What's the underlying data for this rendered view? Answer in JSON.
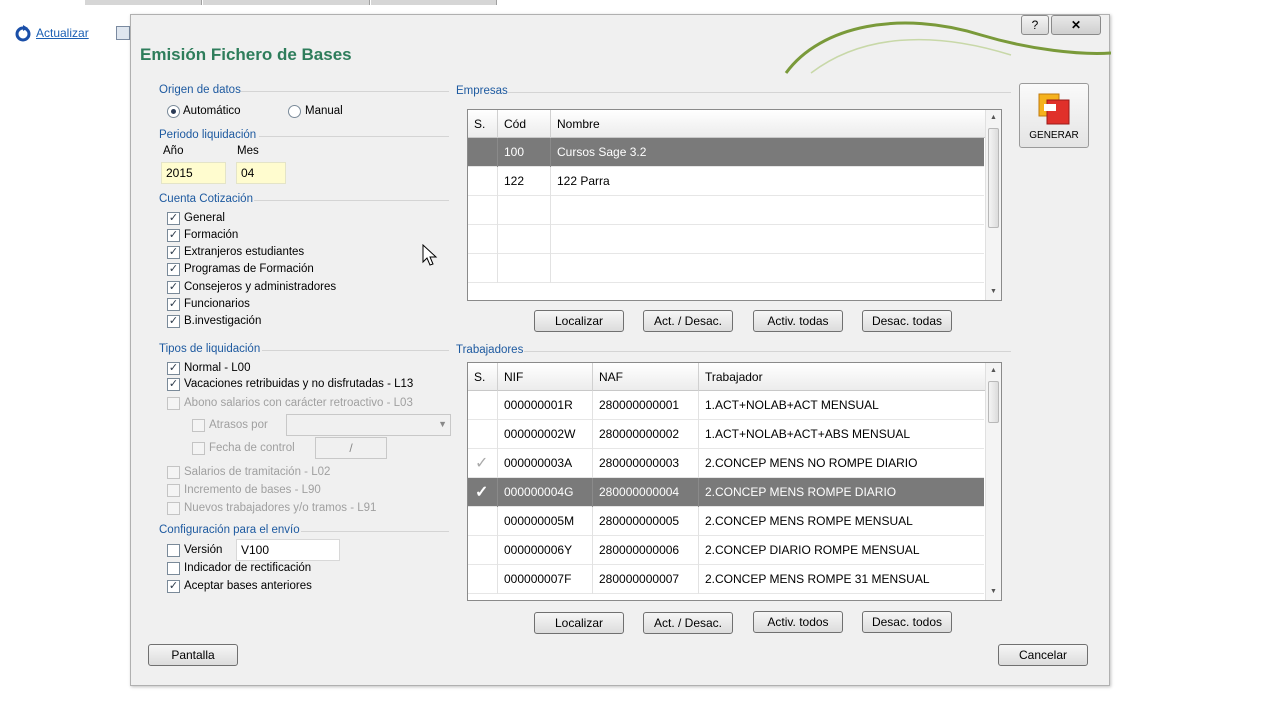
{
  "toolbar": {
    "refresh_label": "Actualizar"
  },
  "dialog": {
    "title": "Emisión Fichero de Bases",
    "help_label": "?",
    "close_label": "✕",
    "generate_label": "GENERAR",
    "pantalla_label": "Pantalla",
    "cancel_label": "Cancelar"
  },
  "origen": {
    "legend": "Origen de datos",
    "auto_label": "Automático",
    "manual_label": "Manual",
    "selected": "Automático"
  },
  "periodo": {
    "legend": "Periodo liquidación",
    "year_label": "Año",
    "month_label": "Mes",
    "year_value": "2015",
    "month_value": "04"
  },
  "cuenta": {
    "legend": "Cuenta Cotización",
    "items": [
      {
        "label": "General",
        "checked": true
      },
      {
        "label": "Formación",
        "checked": true
      },
      {
        "label": "Extranjeros estudiantes",
        "checked": true
      },
      {
        "label": "Programas de Formación",
        "checked": true
      },
      {
        "label": "Consejeros y administradores",
        "checked": true
      },
      {
        "label": "Funcionarios",
        "checked": true
      },
      {
        "label": "B.investigación",
        "checked": true
      }
    ]
  },
  "tipos": {
    "legend": "Tipos de liquidación",
    "normal": "Normal - L00",
    "vacaciones": "Vacaciones retribuidas y no disfrutadas - L13",
    "abono": "Abono salarios con carácter retroactivo - L03",
    "atrasos": "Atrasos por",
    "fecha_control": "Fecha de control",
    "fecha_value": "/",
    "salarios": "Salarios de tramitación - L02",
    "incremento": "Incremento de bases - L90",
    "nuevos": "Nuevos trabajadores y/o tramos - L91"
  },
  "config": {
    "legend": "Configuración para el envío",
    "version_label": "Versión",
    "version_value": "V100",
    "indicador_label": "Indicador de rectificación",
    "aceptar_label": "Aceptar bases anteriores"
  },
  "empresas": {
    "legend": "Empresas",
    "columns": [
      "S.",
      "Cód",
      "Nombre"
    ],
    "rows": [
      {
        "cod": "100",
        "nombre": "Cursos Sage 3.2",
        "selected": true
      },
      {
        "cod": "122",
        "nombre": "122 Parra",
        "selected": false
      }
    ],
    "buttons": [
      "Localizar",
      "Act. / Desac.",
      "Activ. todas",
      "Desac. todas"
    ]
  },
  "trabajadores": {
    "legend": "Trabajadores",
    "columns": [
      "S.",
      "NIF",
      "NAF",
      "Trabajador"
    ],
    "rows": [
      {
        "mark": "",
        "nif": "000000001R",
        "naf": "280000000001",
        "trabajador": "1.ACT+NOLAB+ACT MENSUAL",
        "selected": false
      },
      {
        "mark": "",
        "nif": "000000002W",
        "naf": "280000000002",
        "trabajador": "1.ACT+NOLAB+ACT+ABS MENSUAL",
        "selected": false
      },
      {
        "mark": "✓",
        "nif": "000000003A",
        "naf": "280000000003",
        "trabajador": "2.CONCEP MENS NO ROMPE DIARIO",
        "selected": false
      },
      {
        "mark": "✓",
        "nif": "000000004G",
        "naf": "280000000004",
        "trabajador": "2.CONCEP MENS ROMPE DIARIO",
        "selected": true
      },
      {
        "mark": "",
        "nif": "000000005M",
        "naf": "280000000005",
        "trabajador": "2.CONCEP MENS ROMPE MENSUAL",
        "selected": false
      },
      {
        "mark": "",
        "nif": "000000006Y",
        "naf": "280000000006",
        "trabajador": "2.CONCEP DIARIO ROMPE MENSUAL",
        "selected": false
      },
      {
        "mark": "",
        "nif": "000000007F",
        "naf": "280000000007",
        "trabajador": "2.CONCEP MENS ROMPE 31 MENSUAL",
        "selected": false
      }
    ],
    "buttons": [
      "Localizar",
      "Act. / Desac.",
      "Activ. todos",
      "Desac. todos"
    ]
  },
  "colors": {
    "title_green": "#2e7d5b",
    "legend_blue": "#1e5aa0",
    "selection_grey": "#7a7a7a"
  }
}
